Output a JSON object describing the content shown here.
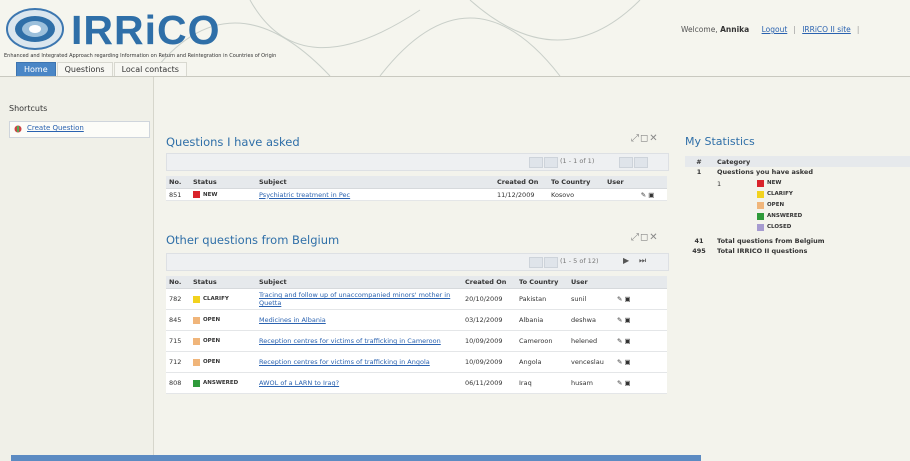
{
  "header": {
    "logo_text": "IRRiCO",
    "tagline": "Enhanced and Integrated Approach regarding Information on Return and Reintegration in Countries of Origin",
    "welcome_label": "Welcome,",
    "user_name": "Annika",
    "logout_label": "Logout",
    "site_link_label": "IRRiCO II site",
    "separator": "|"
  },
  "tabs": [
    {
      "label": "Home",
      "active": true
    },
    {
      "label": "Questions",
      "active": false
    },
    {
      "label": "Local contacts",
      "active": false
    }
  ],
  "sidebar": {
    "title": "Shortcuts",
    "items": [
      {
        "label": "Create Question",
        "icon": "question-add-icon"
      }
    ]
  },
  "asked": {
    "title": "Questions I have asked",
    "controls": "⤢◻✕",
    "pager": "(1 - 1 of 1)",
    "columns": [
      "No.",
      "Status",
      "Subject",
      "Created On",
      "To Country",
      "User"
    ],
    "rows": [
      {
        "no": "851",
        "status": "NEW",
        "subject": "Psychiatric treatment in Pec",
        "created": "11/12/2009",
        "country": "Kosovo",
        "user": ""
      }
    ]
  },
  "other": {
    "title": "Other questions from Belgium",
    "controls": "⤢◻✕",
    "pager": "(1 - 5 of 12)",
    "pager_next": "▶",
    "pager_last": "⏭",
    "columns": [
      "No.",
      "Status",
      "Subject",
      "Created On",
      "To Country",
      "User"
    ],
    "rows": [
      {
        "no": "782",
        "status": "CLARIFY",
        "subject": "Tracing and follow up of unaccompanied minors' mother in Quetta",
        "created": "20/10/2009",
        "country": "Pakistan",
        "user": "sunil"
      },
      {
        "no": "845",
        "status": "OPEN",
        "subject": "Medicines in Albania",
        "created": "03/12/2009",
        "country": "Albania",
        "user": "deshwa"
      },
      {
        "no": "715",
        "status": "OPEN",
        "subject": "Reception centres for victims of trafficking in Cameroon",
        "created": "10/09/2009",
        "country": "Cameroon",
        "user": "helened"
      },
      {
        "no": "712",
        "status": "OPEN",
        "subject": "Reception centres for victims of trafficking in Angola",
        "created": "10/09/2009",
        "country": "Angola",
        "user": "venceslau"
      },
      {
        "no": "808",
        "status": "ANSWERED",
        "subject": "AWOL of a LARN to Iraq?",
        "created": "06/11/2009",
        "country": "Iraq",
        "user": "husam"
      }
    ]
  },
  "stats": {
    "title": "My Statistics",
    "columns": [
      "#",
      "Category"
    ],
    "rows": [
      {
        "num": "1",
        "label": "Questions you have asked"
      },
      {
        "num": "41",
        "label": "Total questions from Belgium"
      },
      {
        "num": "495",
        "label": "Total IRRICO II questions"
      }
    ],
    "sub_num": "1",
    "legend": [
      "NEW",
      "CLARIFY",
      "OPEN",
      "ANSWERED",
      "CLOSED"
    ]
  },
  "status_colors": {
    "NEW": "#d9232b",
    "CLARIFY": "#f2d21e",
    "OPEN": "#f0b57a",
    "ANSWERED": "#2e9a3a",
    "CLOSED": "#a69bd0"
  }
}
